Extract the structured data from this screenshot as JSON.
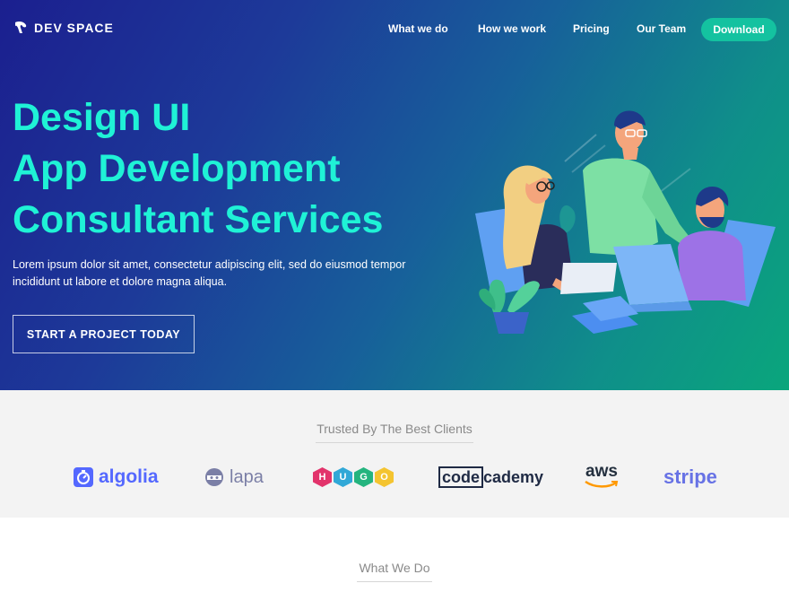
{
  "nav": {
    "brand": "DEV SPACE",
    "links": [
      "What we do",
      "How we work",
      "Pricing",
      "Our Team"
    ],
    "download_label": "Download"
  },
  "hero": {
    "headline_lines": [
      "Design UI",
      "App Development",
      "Consultant Services"
    ],
    "subtext": "Lorem ipsum dolor sit amet, consectetur adipiscing elit, sed do eiusmod tempor incididunt ut labore et dolore magna aliqua.",
    "cta_label": "START A PROJECT TODAY"
  },
  "clients": {
    "title": "Trusted By The Best Clients",
    "logos": {
      "algolia": "algolia",
      "lapa": "lapa",
      "hugo": [
        "H",
        "U",
        "G",
        "O"
      ],
      "codecademy_box": "code",
      "codecademy_rest": "cademy",
      "aws": "aws",
      "stripe": "stripe"
    }
  },
  "what_we_do": {
    "title": "What We Do"
  },
  "colors": {
    "accent": "#1ff2d6",
    "download_bg": "#14c2a0",
    "algolia": "#5468ff",
    "stripe": "#6772e5",
    "hugo_hexes": [
      "#e2336b",
      "#31a8d7",
      "#24b47e",
      "#f4c430"
    ]
  }
}
